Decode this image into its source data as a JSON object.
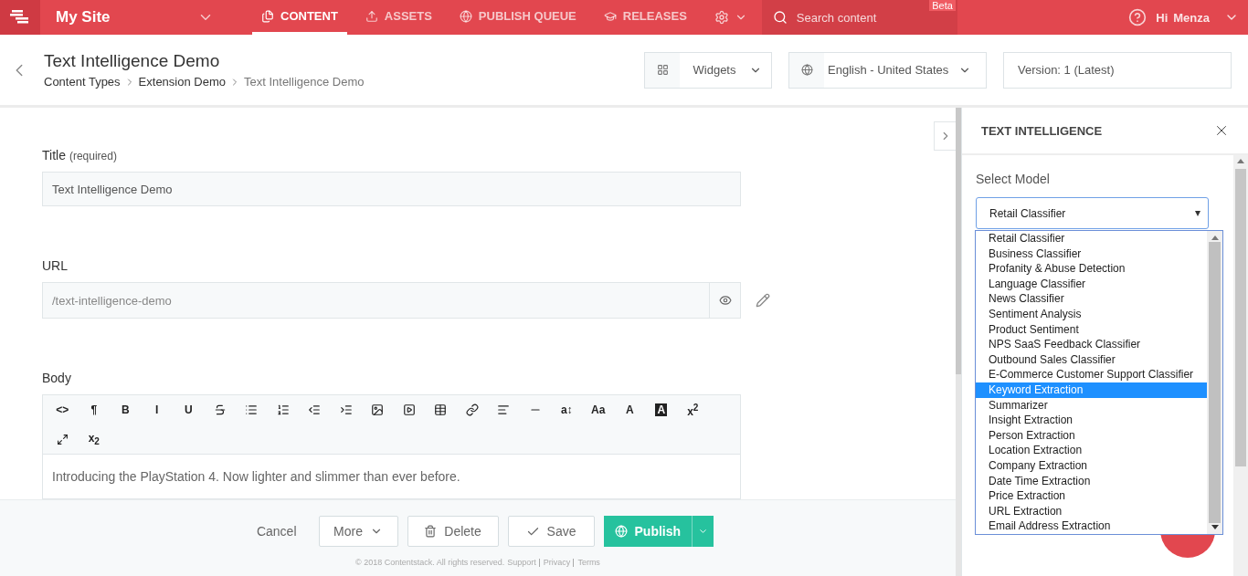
{
  "topbar": {
    "site": "My Site",
    "nav": [
      {
        "label": "CONTENT",
        "selected": true
      },
      {
        "label": "ASSETS",
        "selected": false
      },
      {
        "label": "PUBLISH QUEUE",
        "selected": false
      },
      {
        "label": "RELEASES",
        "selected": false
      }
    ],
    "search": {
      "placeholder": "Search content",
      "badge": "Beta"
    },
    "greeting": "Hi",
    "user": "Menza"
  },
  "header": {
    "title": "Text Intelligence Demo",
    "breadcrumbs": [
      {
        "label": "Content Types",
        "current": false
      },
      {
        "label": "Extension Demo",
        "current": false
      },
      {
        "label": "Text Intelligence Demo",
        "current": true
      }
    ],
    "widgets": "Widgets",
    "locale": "English - United States",
    "version": "Version: 1 (Latest)"
  },
  "form": {
    "title_field": {
      "label": "Title",
      "hint": "(required)",
      "value": "Text Intelligence Demo"
    },
    "url_field": {
      "label": "URL",
      "value": "/text-intelligence-demo"
    },
    "body": {
      "label": "Body",
      "toolbar": [
        {
          "kind": "text",
          "label": "<>"
        },
        {
          "kind": "text",
          "label": "¶"
        },
        {
          "kind": "text",
          "label": "B"
        },
        {
          "kind": "text",
          "label": "I"
        },
        {
          "kind": "text",
          "label": "U"
        },
        {
          "kind": "icon"
        },
        {
          "kind": "icon"
        },
        {
          "kind": "icon"
        },
        {
          "kind": "icon"
        },
        {
          "kind": "icon"
        },
        {
          "kind": "icon"
        },
        {
          "kind": "icon"
        },
        {
          "kind": "icon"
        },
        {
          "kind": "icon"
        },
        {
          "kind": "icon"
        },
        {
          "kind": "icon"
        },
        {
          "kind": "text",
          "label": "a↕"
        },
        {
          "kind": "text",
          "label": "Aa"
        },
        {
          "kind": "text",
          "label": "A"
        },
        {
          "kind": "inverse",
          "label": "A"
        },
        {
          "kind": "text",
          "label": "x$^{2}$"
        },
        {
          "kind": "expand"
        },
        {
          "kind": "text",
          "label": "x$_{2}$"
        }
      ],
      "text": "Introducing the PlayStation 4. Now lighter and slimmer than ever before."
    }
  },
  "actions": {
    "cancel": "Cancel",
    "more": "More",
    "delete": "Delete",
    "save": "Save",
    "publish": "Publish"
  },
  "footer": {
    "copyright": "© 2018 Contentstack. All rights reserved.",
    "links": [
      "Support",
      "Privacy",
      "Terms"
    ]
  },
  "panel": {
    "title": "TEXT INTELLIGENCE",
    "label": "Select Model",
    "value": "Retail Classifier",
    "options": [
      {
        "label": "Retail Classifier",
        "highlighted": false
      },
      {
        "label": "Business Classifier",
        "highlighted": false
      },
      {
        "label": "Profanity & Abuse Detection",
        "highlighted": false
      },
      {
        "label": "Language Classifier",
        "highlighted": false
      },
      {
        "label": "News Classifier",
        "highlighted": false
      },
      {
        "label": "Sentiment Analysis",
        "highlighted": false
      },
      {
        "label": "Product Sentiment",
        "highlighted": false
      },
      {
        "label": "NPS SaaS Feedback Classifier",
        "highlighted": false
      },
      {
        "label": "Outbound Sales Classifier",
        "highlighted": false
      },
      {
        "label": "E-Commerce Customer Support Classifier",
        "highlighted": false
      },
      {
        "label": "Keyword Extraction",
        "highlighted": true
      },
      {
        "label": "Summarizer",
        "highlighted": false
      },
      {
        "label": "Insight Extraction",
        "highlighted": false
      },
      {
        "label": "Person Extraction",
        "highlighted": false
      },
      {
        "label": "Location Extraction",
        "highlighted": false
      },
      {
        "label": "Company Extraction",
        "highlighted": false
      },
      {
        "label": "Date Time Extraction",
        "highlighted": false
      },
      {
        "label": "Price Extraction",
        "highlighted": false
      },
      {
        "label": "URL Extraction",
        "highlighted": false
      },
      {
        "label": "Email Address Extraction",
        "highlighted": false
      }
    ]
  }
}
